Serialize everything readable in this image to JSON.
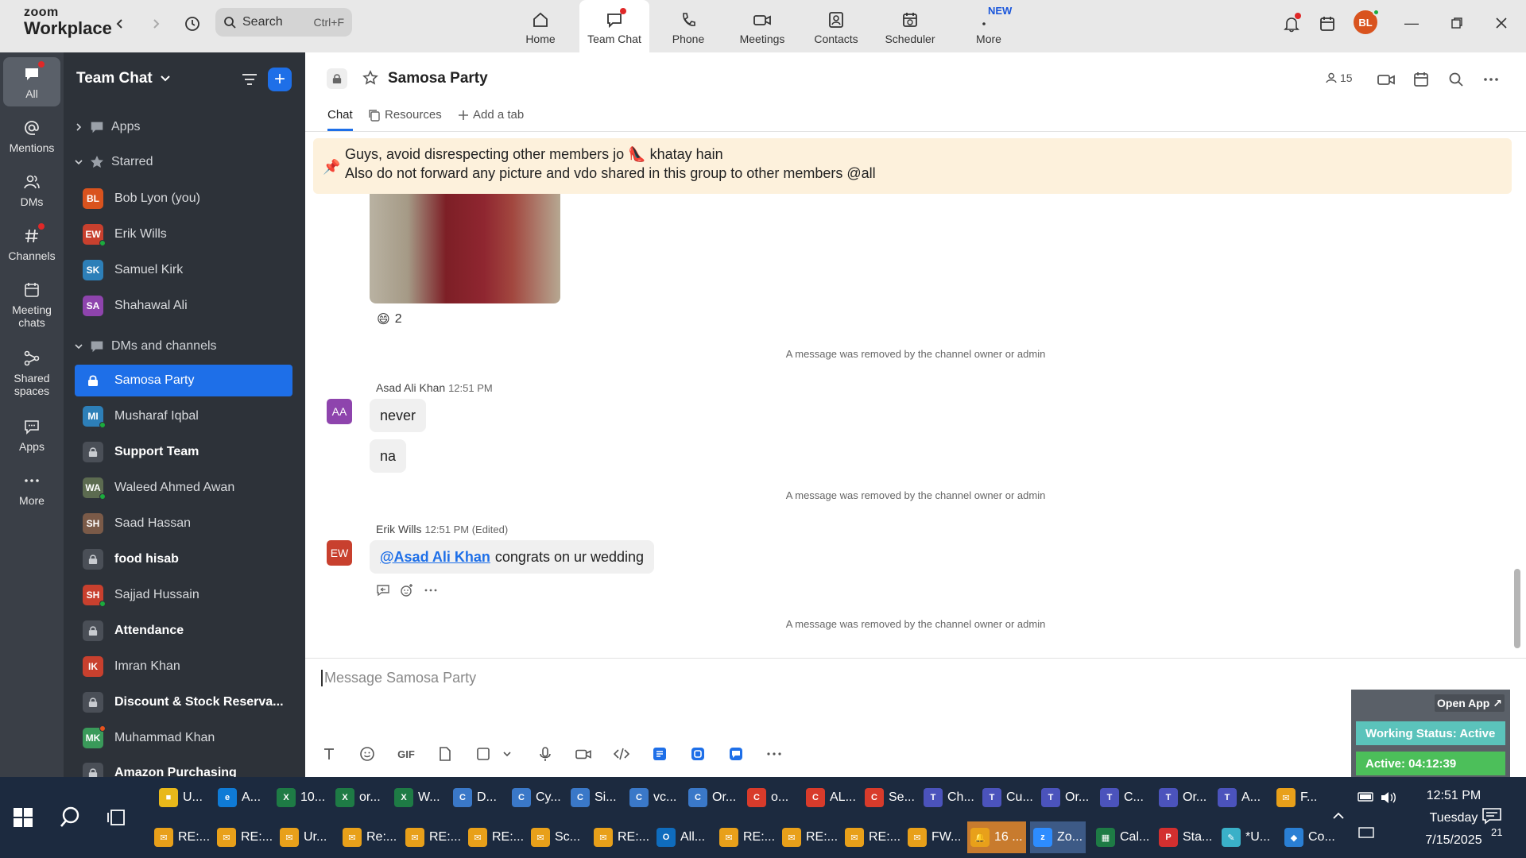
{
  "window": {
    "logo_line1": "zoom",
    "logo_line2": "Workplace",
    "search_placeholder": "Search",
    "search_shortcut": "Ctrl+F",
    "avatar_initials": "BL",
    "new_badge": "NEW"
  },
  "topnav": [
    {
      "label": "Home",
      "icon": "home-icon"
    },
    {
      "label": "Team Chat",
      "icon": "chat-icon",
      "active": true
    },
    {
      "label": "Phone",
      "icon": "phone-icon"
    },
    {
      "label": "Meetings",
      "icon": "video-icon"
    },
    {
      "label": "Contacts",
      "icon": "contacts-icon"
    },
    {
      "label": "Scheduler",
      "icon": "scheduler-icon"
    },
    {
      "label": "More",
      "icon": "more-icon"
    }
  ],
  "rail": [
    {
      "label": "All",
      "icon": "chat-bubble-icon",
      "active": true
    },
    {
      "label": "Mentions",
      "icon": "at-icon"
    },
    {
      "label": "DMs",
      "icon": "people-icon"
    },
    {
      "label": "Channels",
      "icon": "hash-icon"
    },
    {
      "label": "Meeting chats",
      "icon": "calendar-icon"
    },
    {
      "label": "Shared spaces",
      "icon": "shared-icon"
    },
    {
      "label": "Apps",
      "icon": "apps-icon"
    },
    {
      "label": "More",
      "icon": "ellipsis-icon"
    }
  ],
  "sidebar": {
    "title": "Team Chat",
    "apps_label": "Apps",
    "starred_label": "Starred",
    "dms_label": "DMs and channels",
    "starred": [
      {
        "name": "Bob Lyon (you)",
        "initials": "BL",
        "color": "#d9531e"
      },
      {
        "name": "Erik Wills",
        "initials": "EW",
        "color": "#c8402e"
      },
      {
        "name": "Samuel Kirk",
        "initials": "SK",
        "color": "#2d7fb8"
      },
      {
        "name": "Shahawal Ali",
        "initials": "SA",
        "color": "#8e44ad"
      }
    ],
    "channels": [
      {
        "name": "Samosa Party",
        "type": "lock",
        "selected": true
      },
      {
        "name": "Musharaf Iqbal",
        "initials": "MI",
        "color": "#2d7fb8"
      },
      {
        "name": "Support Team",
        "type": "lock",
        "bold": true
      },
      {
        "name": "Waleed Ahmed Awan",
        "initials": "WA",
        "color": "#5c6b50"
      },
      {
        "name": "Saad Hassan",
        "initials": "SH",
        "color": "#7a5a48"
      },
      {
        "name": "food hisab",
        "type": "lock",
        "bold": true
      },
      {
        "name": "Sajjad Hussain",
        "initials": "SH",
        "color": "#c8402e"
      },
      {
        "name": "Attendance",
        "type": "lock",
        "bold": true
      },
      {
        "name": "Imran Khan",
        "initials": "IK",
        "color": "#c8402e"
      },
      {
        "name": "Discount & Stock Reserva...",
        "type": "lock",
        "bold": true
      },
      {
        "name": "Muhammad Khan",
        "initials": "MK",
        "color": "#3a9a5a"
      },
      {
        "name": "Amazon Purchasing",
        "type": "lock",
        "bold": true
      }
    ]
  },
  "channel": {
    "title": "Samosa Party",
    "members": "15",
    "tabs": [
      "Chat",
      "Resources",
      "Add a tab"
    ],
    "pinned_line1": "Guys, avoid disrespecting other members jo 👠 khatay hain",
    "pinned_line2": "Also do not forward any picture and vdo shared in this group to other members @all",
    "reaction_emoji": "😄",
    "reaction_count": "2",
    "removed_text": "A message was removed by the channel owner or admin"
  },
  "messages": [
    {
      "author": "Asad Ali Khan",
      "time": "12:51 PM",
      "initials": "AA",
      "color": "#8e44ad",
      "bubbles": [
        "never",
        "na"
      ]
    },
    {
      "author": "Erik Wills",
      "time": "12:51 PM (Edited)",
      "initials": "EW",
      "color": "#c8402e",
      "mention": "@Asad Ali Khan",
      "text": "congrats on ur wedding"
    }
  ],
  "compose": {
    "placeholder": "Message Samosa Party",
    "gif_label": "GIF"
  },
  "working_status": {
    "open_app": "Open App ↗",
    "status": "Working Status: Active",
    "active": "Active: 04:12:39"
  },
  "taskbar": {
    "row1": [
      {
        "label": "U...",
        "color": "#e8b81a",
        "glyph": "■"
      },
      {
        "label": "A...",
        "color": "#0f7bd6",
        "glyph": "e"
      },
      {
        "label": "10...",
        "color": "#1e7b45",
        "glyph": "X"
      },
      {
        "label": "or...",
        "color": "#1e7b45",
        "glyph": "X"
      },
      {
        "label": "W...",
        "color": "#1e7b45",
        "glyph": "X"
      },
      {
        "label": "D...",
        "color": "#3a78c8",
        "glyph": "C"
      },
      {
        "label": "Cy...",
        "color": "#3a78c8",
        "glyph": "C"
      },
      {
        "label": "Si...",
        "color": "#3a78c8",
        "glyph": "C"
      },
      {
        "label": "vc...",
        "color": "#3a78c8",
        "glyph": "C"
      },
      {
        "label": "Or...",
        "color": "#3a78c8",
        "glyph": "C"
      },
      {
        "label": "o...",
        "color": "#d83b2b",
        "glyph": "C"
      },
      {
        "label": "AL...",
        "color": "#d83b2b",
        "glyph": "C"
      },
      {
        "label": "Se...",
        "color": "#d83b2b",
        "glyph": "C"
      },
      {
        "label": "Ch...",
        "color": "#4b53bc",
        "glyph": "T"
      },
      {
        "label": "Cu...",
        "color": "#4b53bc",
        "glyph": "T"
      },
      {
        "label": "Or...",
        "color": "#4b53bc",
        "glyph": "T"
      },
      {
        "label": "C...",
        "color": "#4b53bc",
        "glyph": "T"
      },
      {
        "label": "Or...",
        "color": "#4b53bc",
        "glyph": "T"
      },
      {
        "label": "A...",
        "color": "#4b53bc",
        "glyph": "T"
      },
      {
        "label": "F...",
        "color": "#e8a01a",
        "glyph": "✉"
      }
    ],
    "row2": [
      {
        "label": "RE:...",
        "color": "#e8a01a",
        "glyph": "✉"
      },
      {
        "label": "RE:...",
        "color": "#e8a01a",
        "glyph": "✉"
      },
      {
        "label": "Ur...",
        "color": "#e8a01a",
        "glyph": "✉"
      },
      {
        "label": "Re:...",
        "color": "#e8a01a",
        "glyph": "✉"
      },
      {
        "label": "RE:...",
        "color": "#e8a01a",
        "glyph": "✉"
      },
      {
        "label": "RE:...",
        "color": "#e8a01a",
        "glyph": "✉"
      },
      {
        "label": "Sc...",
        "color": "#e8a01a",
        "glyph": "✉"
      },
      {
        "label": "RE:...",
        "color": "#e8a01a",
        "glyph": "✉"
      },
      {
        "label": "All...",
        "color": "#0f6cbd",
        "glyph": "O"
      },
      {
        "label": "RE:...",
        "color": "#e8a01a",
        "glyph": "✉"
      },
      {
        "label": "RE:...",
        "color": "#e8a01a",
        "glyph": "✉"
      },
      {
        "label": "RE:...",
        "color": "#e8a01a",
        "glyph": "✉"
      },
      {
        "label": "FW...",
        "color": "#e8a01a",
        "glyph": "✉"
      },
      {
        "label": "16 ...",
        "color": "#e8a01a",
        "glyph": "🔔"
      },
      {
        "label": "Zo...",
        "color": "#2d8cff",
        "glyph": "z"
      },
      {
        "label": "Cal...",
        "color": "#1e7b45",
        "glyph": "▦"
      },
      {
        "label": "Sta...",
        "color": "#d32f2f",
        "glyph": "P"
      },
      {
        "label": "*U...",
        "color": "#3ab0c8",
        "glyph": "✎"
      },
      {
        "label": "Co...",
        "color": "#2a7fd4",
        "glyph": "◆"
      }
    ],
    "time": "12:51 PM",
    "day": "Tuesday",
    "date": "7/15/2025",
    "notif_count": "21"
  }
}
